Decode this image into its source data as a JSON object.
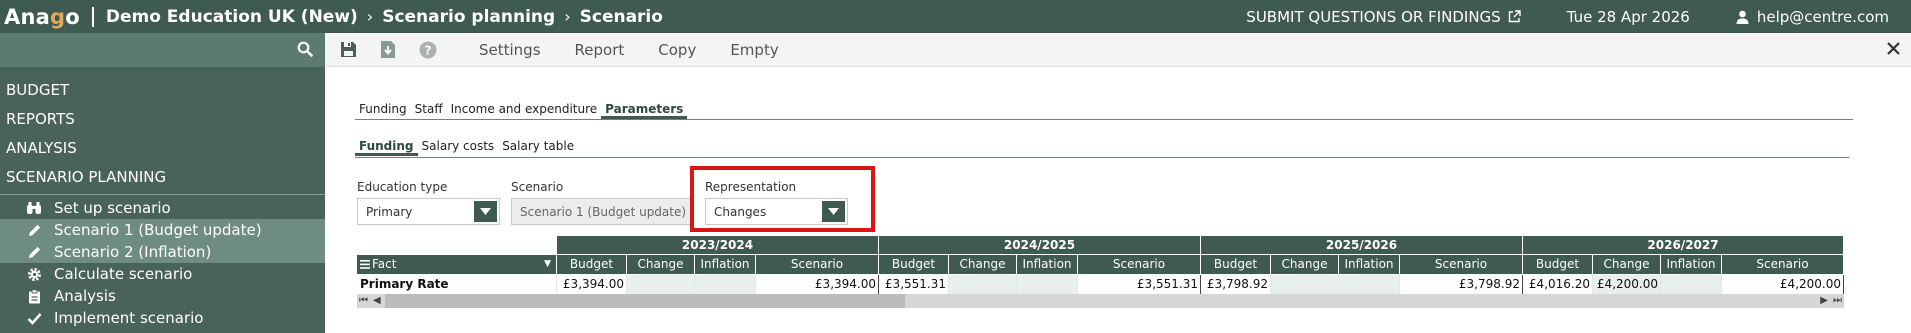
{
  "header": {
    "logo": "Anago",
    "breadcrumbs": [
      "Demo Education UK (New)",
      "Scenario planning",
      "Scenario"
    ],
    "submit_link": "SUBMIT QUESTIONS OR FINDINGS",
    "date": "Tue 28 Apr 2026",
    "user": "help@centre.com"
  },
  "sidebar": {
    "main_items": [
      "BUDGET",
      "REPORTS",
      "ANALYSIS",
      "SCENARIO PLANNING"
    ],
    "sub_items": [
      {
        "label": "Set up scenario",
        "icon": "binoculars-icon",
        "selected": false
      },
      {
        "label": "Scenario 1 (Budget update)",
        "icon": "pencil-icon",
        "selected": true
      },
      {
        "label": "Scenario 2 (Inflation)",
        "icon": "pencil-icon",
        "selected": true
      },
      {
        "label": "Calculate scenario",
        "icon": "gear-icon",
        "selected": false
      },
      {
        "label": "Analysis",
        "icon": "clipboard-icon",
        "selected": false
      },
      {
        "label": "Implement scenario",
        "icon": "check-icon",
        "selected": false
      }
    ]
  },
  "toolbar": {
    "links": [
      "Settings",
      "Report",
      "Copy",
      "Empty"
    ]
  },
  "tabs": {
    "primary": [
      "Funding",
      "Staff",
      "Income and expenditure",
      "Parameters"
    ],
    "primary_active": "Parameters",
    "secondary": [
      "Funding",
      "Salary costs",
      "Salary table"
    ],
    "secondary_active": "Funding"
  },
  "filters": {
    "education_type": {
      "label": "Education type",
      "value": "Primary"
    },
    "scenario": {
      "label": "Scenario",
      "value": "Scenario 1 (Budget update)"
    },
    "representation": {
      "label": "Representation",
      "value": "Changes"
    }
  },
  "grid": {
    "fact_header": "Fact",
    "years": [
      "2023/2024",
      "2024/2025",
      "2025/2026",
      "2026/2027"
    ],
    "columns": [
      "Budget",
      "Change",
      "Inflation %",
      "Scenario"
    ],
    "rows": [
      {
        "fact": "Primary Rate",
        "values": [
          [
            "£3,394.00",
            "",
            "",
            "£3,394.00"
          ],
          [
            "£3,551.31",
            "",
            "",
            "£3,551.31"
          ],
          [
            "£3,798.92",
            "",
            "",
            "£3,798.92"
          ],
          [
            "£4,016.20",
            "£4,200.00",
            "",
            "£4,200.00"
          ]
        ]
      }
    ]
  },
  "colors": {
    "brand": "#3f5a50",
    "sidebar": "#4a6359",
    "highlight": "#d91515"
  }
}
